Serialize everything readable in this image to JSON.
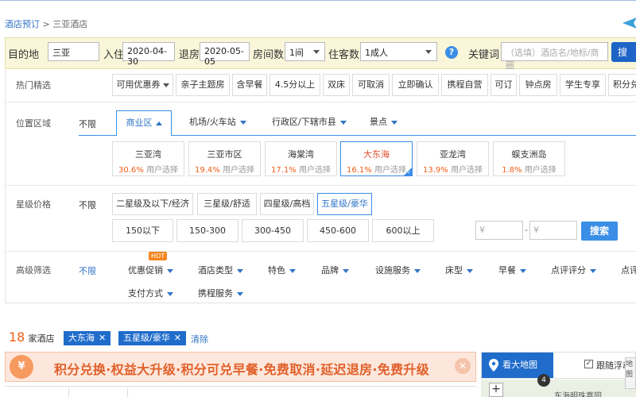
{
  "breadcrumb": {
    "home": "酒店预订",
    "sep": ">",
    "current": "三亚酒店"
  },
  "search": {
    "dest_label": "目的地",
    "dest_value": "三亚",
    "checkin_label": "入住",
    "checkin_value": "2020-04-30",
    "checkout_label": "退房",
    "checkout_value": "2020-05-05",
    "rooms_label": "房间数",
    "rooms_value": "1间",
    "guests_label": "住客数",
    "guests_value": "1成人",
    "help": "?",
    "keyword_label": "关键词",
    "keyword_placeholder": "（选填）酒店名/地标/商圈"
  },
  "filters": {
    "hot_title": "热门精选",
    "hot_tags": [
      "可用优惠券",
      "亲子主题房",
      "含早餐",
      "4.5分以上",
      "双床",
      "可取消",
      "立即确认",
      "携程自营",
      "可订",
      "钟点房",
      "学生专享",
      "积分兑"
    ],
    "location_title": "位置区域",
    "unlimited": "不限",
    "location_tabs": [
      "商业区",
      "机场/火车站",
      "行政区/下辖市县",
      "景点"
    ],
    "areas": [
      {
        "name": "三亚湾",
        "pct": "30.6%",
        "suffix": "用户选择"
      },
      {
        "name": "三亚市区",
        "pct": "19.4%",
        "suffix": "用户选择"
      },
      {
        "name": "海棠湾",
        "pct": "17.1%",
        "suffix": "用户选择"
      },
      {
        "name": "大东海",
        "pct": "16.1%",
        "suffix": "用户选择"
      },
      {
        "name": "亚龙湾",
        "pct": "13.9%",
        "suffix": "用户选择"
      },
      {
        "name": "蜈支洲岛",
        "pct": "1.8%",
        "suffix": "用户选择"
      }
    ],
    "star_title": "星级价格",
    "stars": [
      "二星级及以下/经济",
      "三星级/舒适",
      "四星级/高档",
      "五星级/豪华"
    ],
    "prices": [
      "150以下",
      "150-300",
      "300-450",
      "450-600",
      "600以上"
    ],
    "price_min_placeholder": "¥",
    "price_max_placeholder": "¥",
    "price_dash": "-",
    "price_search": "搜索",
    "adv_title": "高级筛选",
    "hot_badge": "HOT",
    "adv_row1": [
      "优惠促销",
      "酒店类型",
      "特色",
      "品牌",
      "设施服务",
      "床型",
      "早餐",
      "点评评分",
      "点评"
    ],
    "adv_row2": [
      "支付方式",
      "携程服务"
    ]
  },
  "results": {
    "count": "18",
    "count_suffix": "家酒店",
    "selected": [
      "大东海",
      "五星级/豪华"
    ],
    "remove_icon": "✕",
    "clear": "清除"
  },
  "banner": {
    "coin": "¥",
    "text": "积分兑换·权益大升级·积分可兑早餐·免费取消·延迟退房·免费升级",
    "close": "✕"
  },
  "map": {
    "big_map": "看大地图",
    "follow": "跟随浮动",
    "check": "✓",
    "zoom": "+",
    "poi": "东海明珠嘉园",
    "marker": "4",
    "side": "地图"
  },
  "colors": {
    "accent": "#1f6ccb",
    "highlight": "#f0601b",
    "search_bg": "#f9f6d9"
  },
  "search_button": "搜"
}
